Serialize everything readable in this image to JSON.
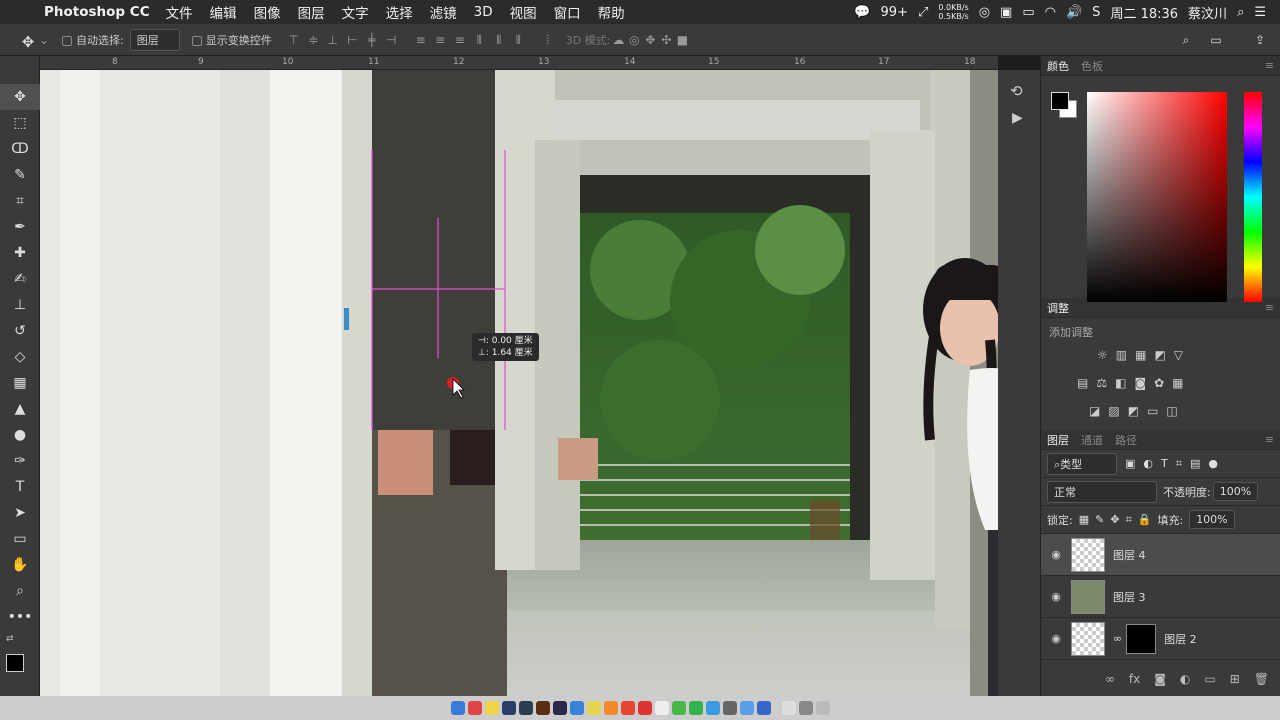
{
  "menubar": {
    "app": "Photoshop CC",
    "menus": [
      "文件",
      "编辑",
      "图像",
      "图层",
      "文字",
      "选择",
      "滤镜",
      "3D",
      "视图",
      "窗口",
      "帮助"
    ],
    "notif_count": "99+",
    "net_up": "0.0KB/s",
    "net_down": "0.5KB/s",
    "clock": "周二 18:36",
    "user": "蔡汶川"
  },
  "options": {
    "auto_select_label": "自动选择:",
    "auto_select_value": "图层",
    "show_transform_label": "显示变换控件",
    "mode_3d_label": "3D 模式:"
  },
  "ruler": {
    "ticks": [
      "8",
      "9",
      "10",
      "11",
      "12",
      "13",
      "14",
      "15",
      "16",
      "17",
      "18"
    ]
  },
  "measure": {
    "line1": "⊣: 0.00 厘米",
    "line2": "⊥: 1.64 厘米"
  },
  "panels": {
    "color_tab": "颜色",
    "swatches_tab": "色板",
    "adjust_title": "调整",
    "adjust_add": "添加调整",
    "layers_tab": "图层",
    "channels_tab": "通道",
    "paths_tab": "路径",
    "filter_kind": "类型",
    "blend_mode": "正常",
    "opacity_label": "不透明度:",
    "opacity_value": "100%",
    "lock_label": "锁定:",
    "fill_label": "填充:",
    "fill_value": "100%"
  },
  "layers": [
    {
      "name": "图层 4",
      "selected": true
    },
    {
      "name": "图层 3",
      "selected": false
    },
    {
      "name": "图层 2",
      "selected": false
    }
  ]
}
